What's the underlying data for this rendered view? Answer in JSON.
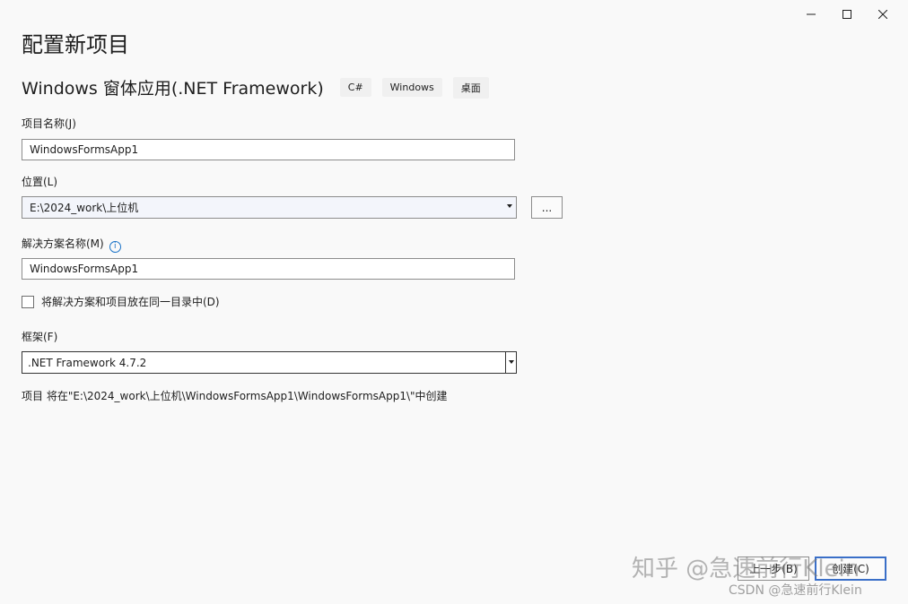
{
  "window": {
    "minimize_label": "minimize",
    "maximize_label": "maximize",
    "close_label": "close"
  },
  "header": {
    "title": "配置新项目",
    "project_type": "Windows 窗体应用(.NET Framework)",
    "tags": [
      "C#",
      "Windows",
      "桌面"
    ]
  },
  "form": {
    "project_name_label": "项目名称(J)",
    "project_name_value": "WindowsFormsApp1",
    "location_label": "位置(L)",
    "location_value": "E:\\2024_work\\上位机",
    "browse_label": "...",
    "solution_name_label": "解决方案名称(M)",
    "solution_name_value": "WindowsFormsApp1",
    "same_directory_label": "将解决方案和项目放在同一目录中(D)",
    "same_directory_checked": false,
    "framework_label": "框架(F)",
    "framework_value": ".NET Framework 4.7.2",
    "path_note": "项目 将在\"E:\\2024_work\\上位机\\WindowsFormsApp1\\WindowsFormsApp1\\\"中创建"
  },
  "footer": {
    "back_label": "上一步(B)",
    "create_label": "创建(C)"
  },
  "watermark": {
    "main": "知乎 @急速前行Klein",
    "small": "CSDN @急速前行Klein"
  },
  "colors": {
    "background": "#f9f9f9",
    "accent": "#3a6fc8",
    "info": "#1a73c8"
  }
}
